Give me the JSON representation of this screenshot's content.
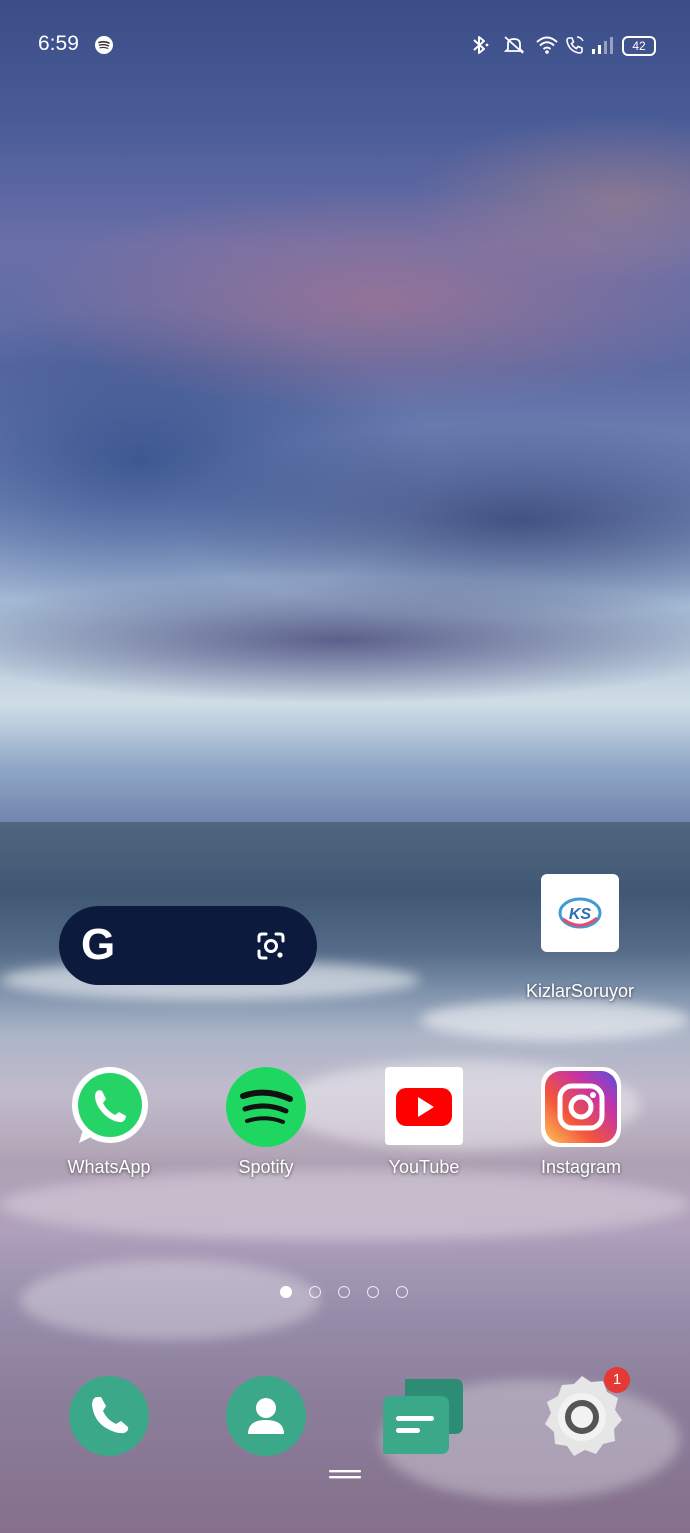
{
  "status_bar": {
    "time": "6:59",
    "battery": "42",
    "icons": [
      "spotify-icon",
      "bluetooth-icon",
      "mute-icon",
      "wifi-icon",
      "wifi-calling-icon",
      "signal-icon",
      "battery-icon"
    ]
  },
  "search_widget": {
    "logo": "G",
    "icons": [
      "google-g-icon",
      "google-lens-icon"
    ]
  },
  "apps": [
    {
      "label": "KizlarSoruyor",
      "icon": "kizlarsoruyor-icon"
    },
    {
      "label": "WhatsApp",
      "icon": "whatsapp-icon"
    },
    {
      "label": "Spotify",
      "icon": "spotify-icon"
    },
    {
      "label": "YouTube",
      "icon": "youtube-icon"
    },
    {
      "label": "Instagram",
      "icon": "instagram-icon"
    }
  ],
  "kizlarsoruyor_logo_text": "KS",
  "page_indicator": {
    "count": 5,
    "active": 1
  },
  "dock": [
    {
      "icon": "phone-icon"
    },
    {
      "icon": "contacts-icon"
    },
    {
      "icon": "messages-icon"
    },
    {
      "icon": "settings-icon",
      "badge": "1"
    }
  ],
  "colors": {
    "dock_green": "#3aa889",
    "spotify_green": "#1ed760",
    "whatsapp_green": "#25d366",
    "youtube_red": "#ff0000",
    "badge_red": "#e53935",
    "search_pill": "#0c1a3d"
  }
}
